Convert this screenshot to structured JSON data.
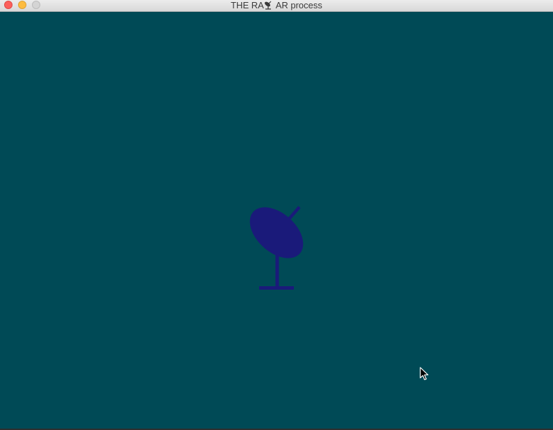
{
  "window": {
    "title_left": "THE RA",
    "title_right": "AR process",
    "title_icon": "radar-dish-icon",
    "controls": [
      "close",
      "minimize",
      "zoom"
    ]
  },
  "canvas": {
    "background_color": "#004a56",
    "dish_color": "#1a1a7a",
    "icon": "radar-dish-icon"
  },
  "cursor": {
    "icon": "mouse-pointer-icon"
  }
}
